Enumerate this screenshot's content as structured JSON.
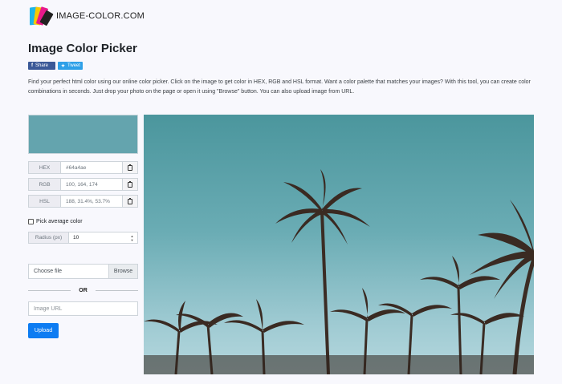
{
  "header": {
    "site_name": "IMAGE-COLOR.COM"
  },
  "page": {
    "title": "Image Color Picker",
    "share": {
      "facebook_label": "Share",
      "twitter_label": "Tweet"
    },
    "description": "Find your perfect html color using our online color picker. Click on the image to get color in HEX, RGB and HSL format. Want a color palette that matches your images? With this tool, you can create color combinations in seconds. Just drop your photo on the page or open it using \"Browse\" button. You can also upload image from URL."
  },
  "picker": {
    "swatch_color": "#64a4ae",
    "hex": {
      "label": "HEX",
      "value": "#64a4ae"
    },
    "rgb": {
      "label": "RGB",
      "value": "100, 164, 174"
    },
    "hsl": {
      "label": "HSL",
      "value": "188, 31.4%, 53.7%"
    },
    "average_label": "Pick average color",
    "radius": {
      "label": "Radius (px)",
      "value": "10"
    }
  },
  "upload": {
    "file_placeholder": "Choose file",
    "browse_label": "Browse",
    "or_label": "OR",
    "url_placeholder": "Image URL",
    "upload_label": "Upload"
  },
  "colors": {
    "accent": "#0d7cf2",
    "facebook": "#3b5998",
    "twitter": "#2ea0e8"
  }
}
